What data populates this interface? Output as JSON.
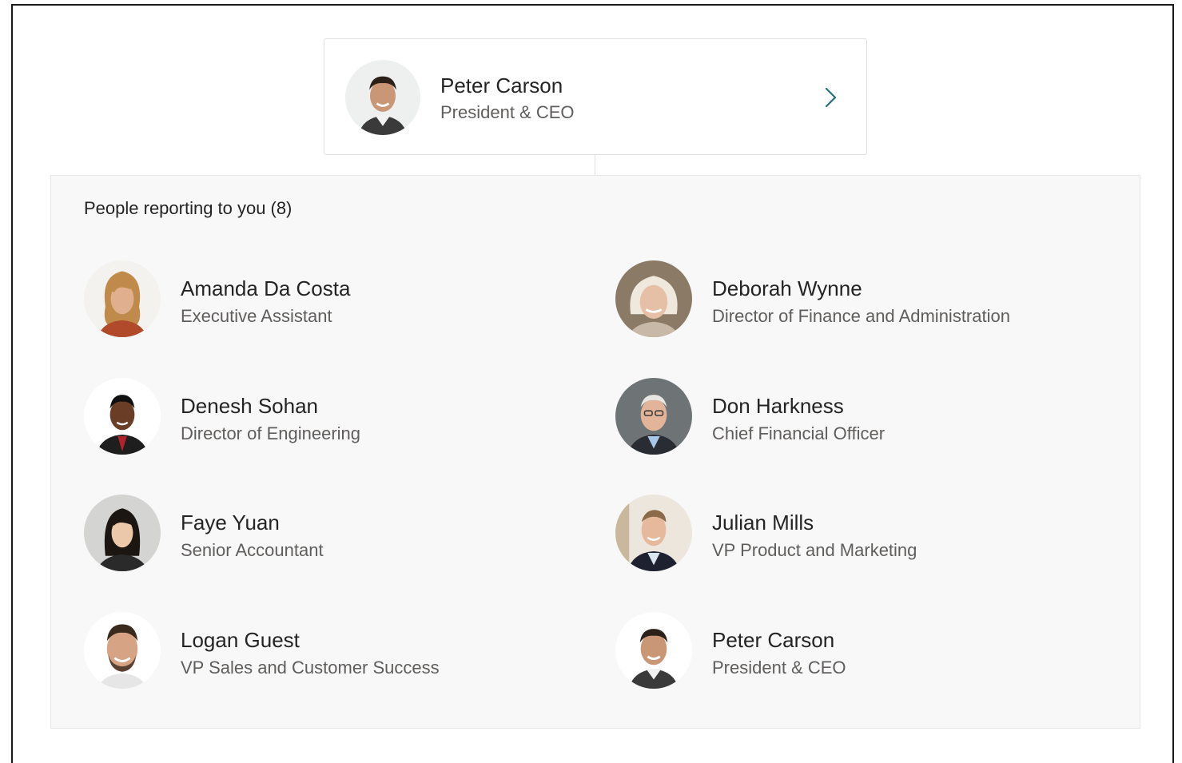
{
  "manager": {
    "name": "Peter Carson",
    "title": "President & CEO",
    "avatar_icon": "avatar-peter-carson"
  },
  "reports": {
    "header": "People reporting to you",
    "count": "(8)",
    "people": [
      {
        "name": "Amanda Da Costa",
        "title": "Executive Assistant"
      },
      {
        "name": "Deborah Wynne",
        "title": "Director of Finance and Administration"
      },
      {
        "name": "Denesh Sohan",
        "title": "Director of Engineering"
      },
      {
        "name": "Don Harkness",
        "title": "Chief Financial Officer"
      },
      {
        "name": "Faye Yuan",
        "title": "Senior Accountant"
      },
      {
        "name": "Julian Mills",
        "title": "VP Product and Marketing"
      },
      {
        "name": "Logan Guest",
        "title": "VP Sales and Customer Success"
      },
      {
        "name": "Peter Carson",
        "title": "President & CEO"
      }
    ]
  },
  "colors": {
    "primary_text": "#252424",
    "secondary_text": "#605e5c",
    "panel_bg": "#f8f8f8",
    "border": "#e1dfdd",
    "chevron": "#2b6f7f"
  }
}
